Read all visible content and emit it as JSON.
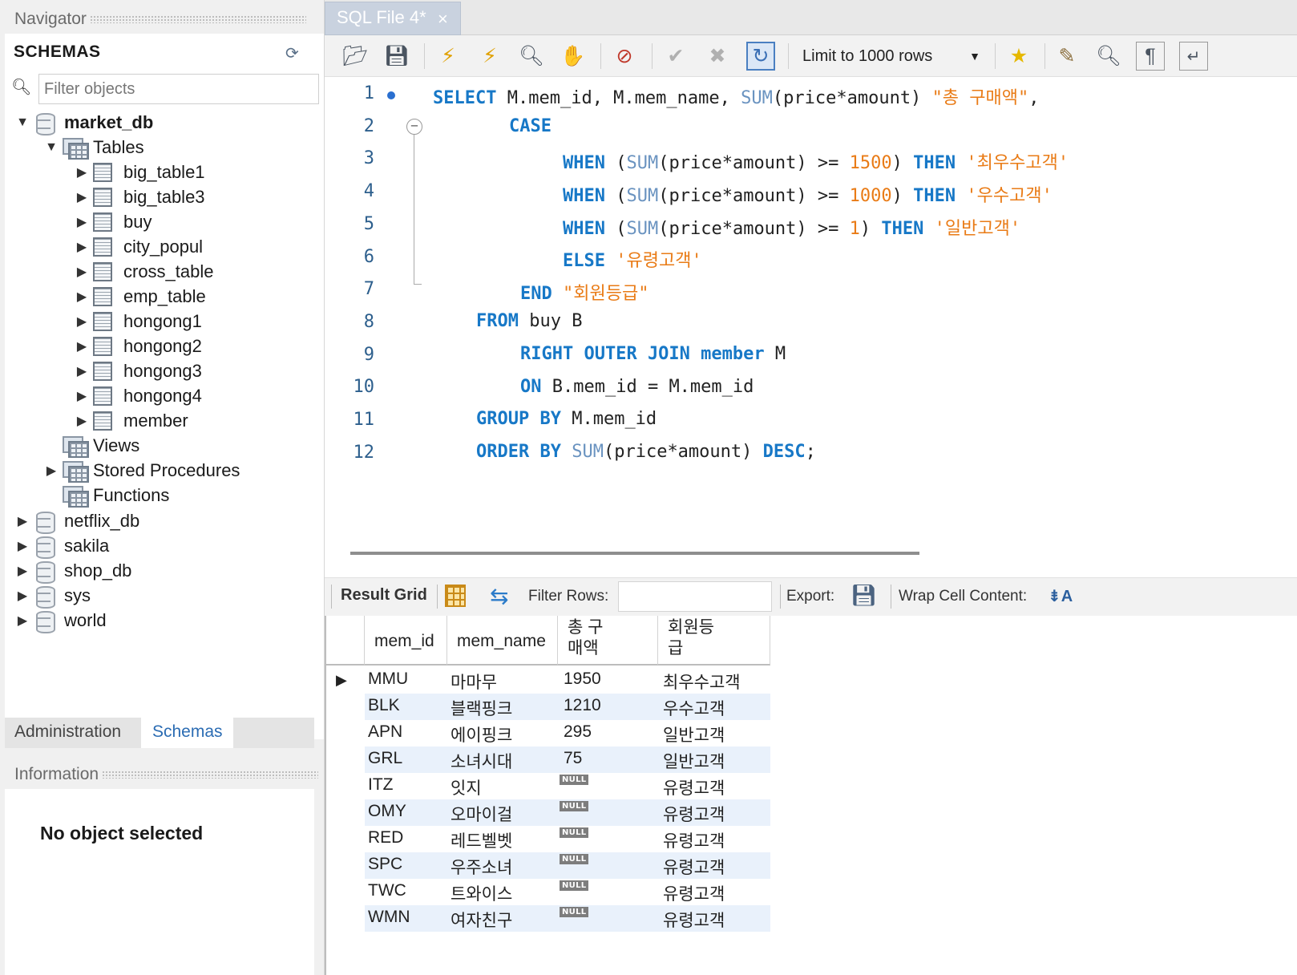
{
  "navigator": {
    "header": "Navigator",
    "schemas_title": "SCHEMAS",
    "filter_placeholder": "Filter objects",
    "tree": {
      "market_db": "market_db",
      "tables": "Tables",
      "table_items": [
        "big_table1",
        "big_table3",
        "buy",
        "city_popul",
        "cross_table",
        "emp_table",
        "hongong1",
        "hongong2",
        "hongong3",
        "hongong4",
        "member"
      ],
      "views": "Views",
      "stored_procedures": "Stored Procedures",
      "functions": "Functions",
      "other_dbs": [
        "netflix_db",
        "sakila",
        "shop_db",
        "sys",
        "world"
      ]
    },
    "tabs": {
      "administration": "Administration",
      "schemas": "Schemas"
    },
    "information_header": "Information",
    "no_object": "No object selected"
  },
  "editor_tab": {
    "label": "SQL File 4*",
    "close": "×"
  },
  "toolbar": {
    "limit_label": "Limit to 1000 rows",
    "icons": [
      "open-folder-icon",
      "save-icon",
      "execute-icon",
      "execute-current-icon",
      "explain-icon",
      "stop-icon",
      "stop-on-error-icon",
      "commit-icon",
      "rollback-icon",
      "autocommit-icon",
      "add-snippet-icon",
      "beautify-icon",
      "find-icon",
      "invisible-chars-icon",
      "wrap-lines-icon"
    ]
  },
  "sql": {
    "line_numbers": [
      "1",
      "2",
      "3",
      "4",
      "5",
      "6",
      "7",
      "8",
      "9",
      "10",
      "11",
      "12"
    ],
    "l1": {
      "kw1": "SELECT",
      "t1": " M.mem_id, M.mem_name, ",
      "fn": "SUM",
      "t2": "(price*amount) ",
      "str": "\"총 구매액\"",
      "t3": ","
    },
    "l2": {
      "kw": "CASE"
    },
    "l3": {
      "kw1": "WHEN",
      "t1": " (",
      "fn": "SUM",
      "t2": "(price*amount) >= ",
      "num": "1500",
      "t3": ") ",
      "kw2": "THEN",
      "t4": " ",
      "str": "'최우수고객'"
    },
    "l4": {
      "kw1": "WHEN",
      "t1": " (",
      "fn": "SUM",
      "t2": "(price*amount) >= ",
      "num": "1000",
      "t3": ") ",
      "kw2": "THEN",
      "t4": " ",
      "str": "'우수고객'"
    },
    "l5": {
      "kw1": "WHEN",
      "t1": " (",
      "fn": "SUM",
      "t2": "(price*amount) >= ",
      "num": "1",
      "t3": ") ",
      "kw2": "THEN",
      "t4": " ",
      "str": "'일반고객'"
    },
    "l6": {
      "kw": "ELSE",
      "t1": " ",
      "str": "'유령고객'"
    },
    "l7": {
      "kw": "END",
      "t1": " ",
      "str": "\"회원등급\""
    },
    "l8": {
      "kw": "FROM",
      "t1": " buy B"
    },
    "l9": {
      "kw": "RIGHT OUTER JOIN member",
      "t1": " M"
    },
    "l10": {
      "kw": "ON",
      "t1": " B.mem_id = M.mem_id"
    },
    "l11": {
      "kw": "GROUP BY",
      "t1": " M.mem_id"
    },
    "l12": {
      "kw1": "ORDER BY",
      "t1": " ",
      "fn": "SUM",
      "t2": "(price*amount) ",
      "kw2": "DESC",
      "t3": ";"
    }
  },
  "result_toolbar": {
    "result_grid": "Result Grid",
    "filter_rows": "Filter Rows:",
    "export": "Export:",
    "wrap_cell": "Wrap Cell Content:",
    "wrap_icon": "⇟A"
  },
  "grid": {
    "headers": {
      "mem_id": "mem_id",
      "mem_name": "mem_name",
      "total_a": "총 구",
      "total_b": "매액",
      "grade_a": "회원등",
      "grade_b": "급"
    },
    "null_text": "NULL",
    "rows": [
      {
        "mem_id": "MMU",
        "mem_name": "마마무",
        "total": "1950",
        "grade": "최우수고객"
      },
      {
        "mem_id": "BLK",
        "mem_name": "블랙핑크",
        "total": "1210",
        "grade": "우수고객"
      },
      {
        "mem_id": "APN",
        "mem_name": "에이핑크",
        "total": "295",
        "grade": "일반고객"
      },
      {
        "mem_id": "GRL",
        "mem_name": "소녀시대",
        "total": "75",
        "grade": "일반고객"
      },
      {
        "mem_id": "ITZ",
        "mem_name": "잇지",
        "total": null,
        "grade": "유령고객"
      },
      {
        "mem_id": "OMY",
        "mem_name": "오마이걸",
        "total": null,
        "grade": "유령고객"
      },
      {
        "mem_id": "RED",
        "mem_name": "레드벨벳",
        "total": null,
        "grade": "유령고객"
      },
      {
        "mem_id": "SPC",
        "mem_name": "우주소녀",
        "total": null,
        "grade": "유령고객"
      },
      {
        "mem_id": "TWC",
        "mem_name": "트와이스",
        "total": null,
        "grade": "유령고객"
      },
      {
        "mem_id": "WMN",
        "mem_name": "여자친구",
        "total": null,
        "grade": "유령고객"
      }
    ]
  },
  "colors": {
    "keyword": "#1778c7",
    "string": "#e97b16",
    "accent": "#2b6cb3",
    "null_badge": "#7d7d7d"
  }
}
